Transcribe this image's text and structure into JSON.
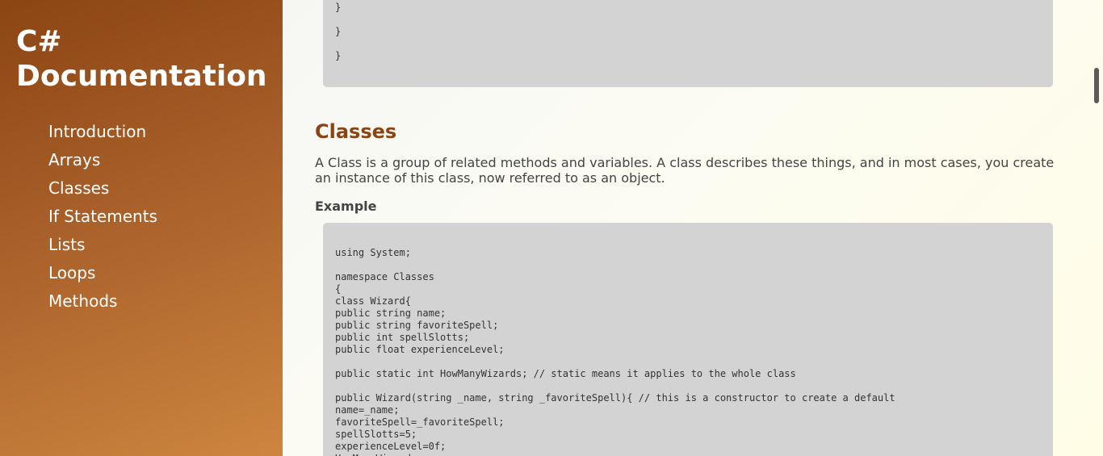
{
  "sidebar": {
    "title": "C# Documentation",
    "nav": [
      {
        "label": "Introduction"
      },
      {
        "label": "Arrays"
      },
      {
        "label": "Classes"
      },
      {
        "label": "If Statements"
      },
      {
        "label": "Lists"
      },
      {
        "label": "Loops"
      },
      {
        "label": "Methods"
      }
    ]
  },
  "main": {
    "previous_code_tail": [
      "}",
      "}",
      "}"
    ],
    "section": {
      "title": "Classes",
      "description": "A Class is a group of related methods and variables. A class describes these things, and in most cases, you create an instance of this class, now referred to as an object.",
      "example_label": "Example",
      "code": "using System;\n\nnamespace Classes\n{\nclass Wizard{\npublic string name;\npublic string favoriteSpell;\npublic int spellSlotts;\npublic float experienceLevel;\n\npublic static int HowManyWizards; // static means it applies to the whole class\n\npublic Wizard(string _name, string _favoriteSpell){ // this is a constructor to create a default\nname=_name;\nfavoriteSpell=_favoriteSpell;\nspellSlotts=5;\nexperienceLevel=0f;\nHowManyWizards++;"
    }
  },
  "colors": {
    "sidebar_start": "#8b4513",
    "sidebar_end": "#cd853f",
    "heading": "#8b4513",
    "code_background": "#d3d3d3"
  }
}
